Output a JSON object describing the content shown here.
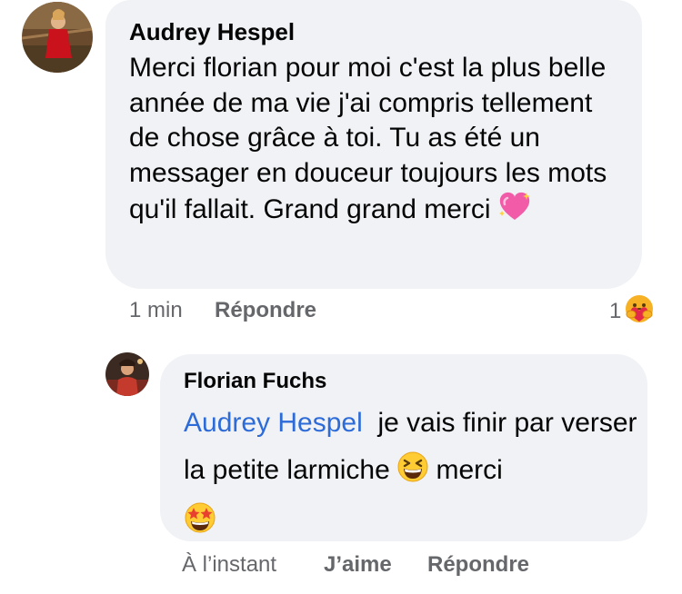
{
  "comment1": {
    "author": "Audrey Hespel",
    "text": "Merci florian pour moi c'est la plus belle année de ma vie j'ai compris tellement de chose grâce à toi. Tu as été un messager en douceur toujours les mots qu'il fallait.  Grand grand merci",
    "emoji": "sparkling-heart",
    "time": "1 min",
    "reply_label": "Répondre",
    "reaction_count": "1",
    "reaction_emoji": "care-hug"
  },
  "comment2": {
    "author": "Florian Fuchs",
    "mention": "Audrey Hespel",
    "text_part1": "je vais finir par verser la petite larmiche",
    "emoji1": "grinning-squinting-face",
    "text_part2": "merci",
    "emoji2": "star-struck",
    "time": "À l’instant",
    "like_label": "J’aime",
    "reply_label": "Répondre"
  },
  "colors": {
    "bubble": "#f0f2f5",
    "mention": "#2d6bd8",
    "meta": "#65676b"
  }
}
